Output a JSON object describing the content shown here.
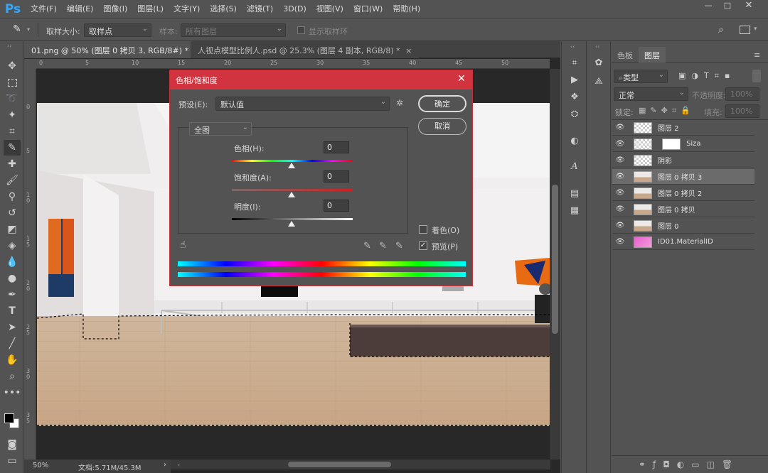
{
  "app": {
    "logo": "Ps"
  },
  "menu": [
    "文件(F)",
    "编辑(E)",
    "图像(I)",
    "图层(L)",
    "文字(Y)",
    "选择(S)",
    "滤镜(T)",
    "3D(D)",
    "视图(V)",
    "窗口(W)",
    "帮助(H)"
  ],
  "options": {
    "sample_size_label": "取样大小:",
    "sample_size_value": "取样点",
    "sample_label": "样本:",
    "sample_value": "所有图层",
    "show_ring_label": "显示取样环"
  },
  "tabs": [
    {
      "label": "01.png @ 50% (图层 0 拷贝 3, RGB/8#) *",
      "close": "×"
    },
    {
      "label": "人视点模型比例人.psd @ 25.3% (图层 4 副本, RGB/8) *",
      "close": "×"
    }
  ],
  "ruler_h": [
    "0",
    "5",
    "10",
    "15",
    "20",
    "25",
    "30",
    "35",
    "40",
    "45",
    "50"
  ],
  "ruler_v": [
    "0",
    "5",
    "1 0",
    "1 5",
    "2 0",
    "2 5",
    "3 0",
    "3 5"
  ],
  "status": {
    "zoom": "50%",
    "doc": "文档:5.71M/45.3M",
    "arrow": "›"
  },
  "dialog": {
    "title": "色相/饱和度",
    "preset_label": "预设(E):",
    "preset_value": "默认值",
    "ok": "确定",
    "cancel": "取消",
    "channel": "全图",
    "hue_label": "色相(H):",
    "hue_value": "0",
    "sat_label": "饱和度(A):",
    "sat_value": "0",
    "light_label": "明度(I):",
    "light_value": "0",
    "colorize_label": "着色(O)",
    "preview_label": "预览(P)",
    "preview_checked": true,
    "colorize_checked": false
  },
  "panel": {
    "tab_swatches": "色板",
    "tab_layers": "图层",
    "filter_label": "类型",
    "blend_mode": "正常",
    "opacity_label": "不透明度:",
    "opacity_value": "100%",
    "lock_label": "锁定:",
    "fill_label": "填充:",
    "fill_value": "100%"
  },
  "layers": [
    {
      "name": "图层 2",
      "thumb": "checker",
      "selected": false
    },
    {
      "name": "Siza",
      "thumb": "checker",
      "selected": false
    },
    {
      "name": "阴影",
      "thumb": "checker",
      "selected": false
    },
    {
      "name": "图层 0 拷贝 3",
      "thumb": "wood",
      "selected": true
    },
    {
      "name": "图层 0 拷贝 2",
      "thumb": "wood",
      "selected": false
    },
    {
      "name": "图层 0 拷贝",
      "thumb": "wood",
      "selected": false
    },
    {
      "name": "图层 0",
      "thumb": "wood",
      "selected": false
    },
    {
      "name": "ID01.MaterialID",
      "thumb": "pink",
      "selected": false
    }
  ],
  "colors": {
    "accent": "#d1343e",
    "ps_blue": "#31a8ff",
    "selected_row": "#6b6b6b"
  }
}
